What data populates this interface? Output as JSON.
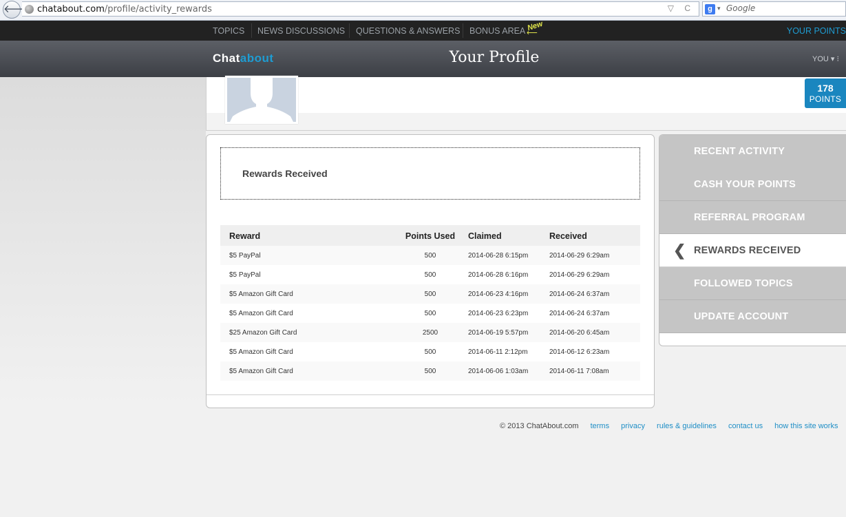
{
  "browser": {
    "url_host": "chatabout.com",
    "url_path": "/profile/activity_rewards",
    "search_placeholder": "Google",
    "back_glyph": "🡐",
    "search_engine_glyph": "g",
    "caret_glyph": "▾",
    "url_icons": "▽ C"
  },
  "nav": {
    "topics": "TOPICS",
    "news": "NEWS DISCUSSIONS",
    "qa": "QUESTIONS & ANSWERS",
    "bonus": "BONUS AREA",
    "new_badge": "New",
    "your_points": "YOUR POINTS"
  },
  "header": {
    "logo_a": "Chat",
    "logo_b": "about",
    "title": "Your Profile",
    "you_menu": "YOU ▾  ⁝"
  },
  "profile": {
    "points": "178",
    "points_label": "POINTS"
  },
  "main": {
    "section_title": "Rewards Received",
    "columns": {
      "reward": "Reward",
      "points": "Points Used",
      "claimed": "Claimed",
      "received": "Received"
    },
    "rows": [
      {
        "reward": "$5 PayPal",
        "points": "500",
        "claimed": "2014-06-28 6:15pm",
        "received": "2014-06-29 6:29am"
      },
      {
        "reward": "$5 PayPal",
        "points": "500",
        "claimed": "2014-06-28 6:16pm",
        "received": "2014-06-29 6:29am"
      },
      {
        "reward": "$5 Amazon Gift Card",
        "points": "500",
        "claimed": "2014-06-23 4:16pm",
        "received": "2014-06-24 6:37am"
      },
      {
        "reward": "$5 Amazon Gift Card",
        "points": "500",
        "claimed": "2014-06-23 6:23pm",
        "received": "2014-06-24 6:37am"
      },
      {
        "reward": "$25 Amazon Gift Card",
        "points": "2500",
        "claimed": "2014-06-19 5:57pm",
        "received": "2014-06-20 6:45am"
      },
      {
        "reward": "$5 Amazon Gift Card",
        "points": "500",
        "claimed": "2014-06-11 2:12pm",
        "received": "2014-06-12 6:23am"
      },
      {
        "reward": "$5 Amazon Gift Card",
        "points": "500",
        "claimed": "2014-06-06 1:03am",
        "received": "2014-06-11 7:08am"
      }
    ]
  },
  "sidebar": {
    "items": [
      {
        "label": "RECENT ACTIVITY"
      },
      {
        "label": "CASH YOUR POINTS"
      },
      {
        "label": "REFERRAL PROGRAM"
      },
      {
        "label": "REWARDS RECEIVED"
      },
      {
        "label": "FOLLOWED TOPICS"
      },
      {
        "label": "UPDATE ACCOUNT"
      }
    ],
    "active_glyph": "❮"
  },
  "footer": {
    "copyright": "© 2013 ChatAbout.com",
    "terms": "terms",
    "privacy": "privacy",
    "rules": "rules & guidelines",
    "contact": "contact us",
    "how": "how this site works"
  },
  "colors": {
    "accent": "#1e9cd2",
    "nav_bg": "#222222",
    "sidebar_bg": "#c5c5c5",
    "points_badge": "#1a86bf"
  }
}
